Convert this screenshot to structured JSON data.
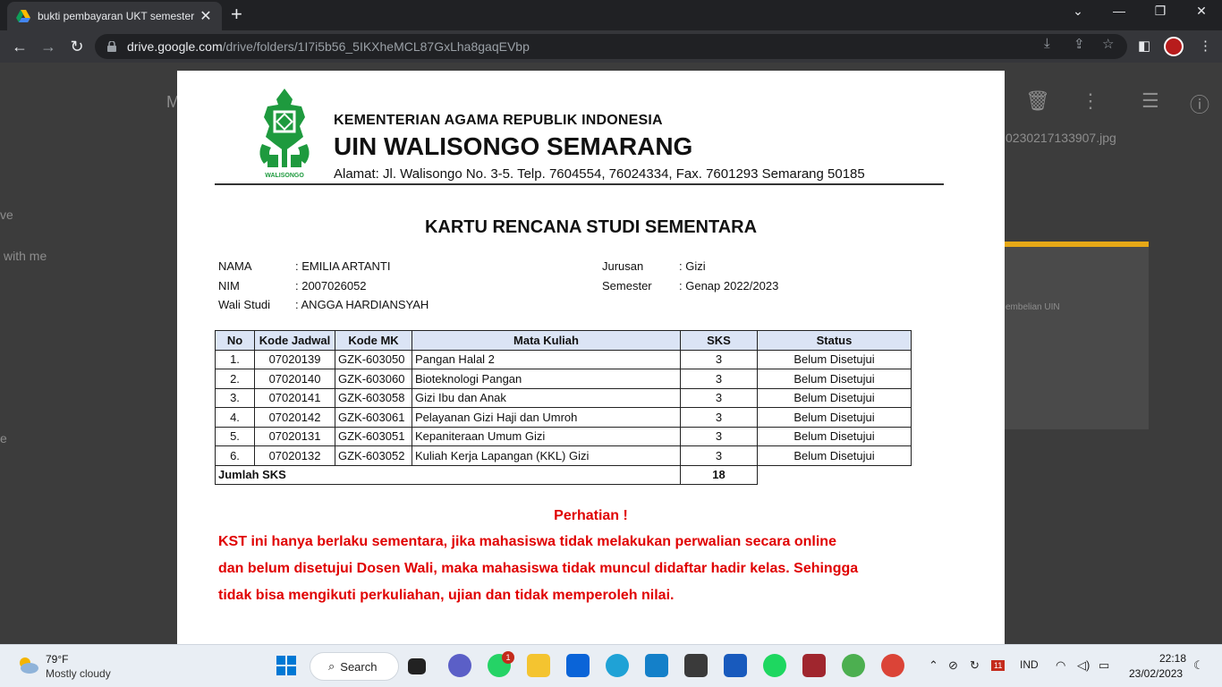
{
  "browser": {
    "tab_title": "bukti pembayaran UKT semester",
    "tab_close": "✕",
    "new_tab": "+",
    "url_host": "drive.google.com",
    "url_path": "/drive/folders/1I7i5b56_5IKXheMCL87GxLha8gaqEVbp",
    "minimize": "⌄",
    "minimize2": "—",
    "restore": "❐",
    "close": "✕"
  },
  "drive_background": {
    "partial_top": "M",
    "partial_left_1": "ve",
    "partial_left_2": "with me",
    "partial_left_3": "e",
    "file_name": "0230217133907.jpg",
    "thumb_text": "embelian UIN"
  },
  "document": {
    "ministry": "KEMENTERIAN AGAMA REPUBLIK INDONESIA",
    "university": "UIN WALISONGO SEMARANG",
    "address": "Alamat: Jl. Walisongo No. 3-5. Telp. 7604554, 76024334, Fax. 7601293 Semarang 50185",
    "logo_text": "WALISONGO",
    "title": "KARTU RENCANA STUDI SEMENTARA",
    "info": {
      "nama_label": "NAMA",
      "nama_value": ": EMILIA ARTANTI",
      "nim_label": "NIM",
      "nim_value": ": 2007026052",
      "wali_label": "Wali Studi",
      "wali_value": ": ANGGA HARDIANSYAH",
      "jurusan_label": "Jurusan",
      "jurusan_value": ": Gizi",
      "semester_label": "Semester",
      "semester_value": ": Genap 2022/2023"
    },
    "table": {
      "headers": [
        "No",
        "Kode Jadwal",
        "Kode MK",
        "Mata Kuliah",
        "SKS",
        "Status"
      ],
      "rows": [
        [
          "1.",
          "07020139",
          "GZK-603050",
          "Pangan Halal 2",
          "3",
          "Belum Disetujui"
        ],
        [
          "2.",
          "07020140",
          "GZK-603060",
          "Bioteknologi Pangan",
          "3",
          "Belum Disetujui"
        ],
        [
          "3.",
          "07020141",
          "GZK-603058",
          "Gizi Ibu dan Anak",
          "3",
          "Belum Disetujui"
        ],
        [
          "4.",
          "07020142",
          "GZK-603061",
          "Pelayanan Gizi Haji dan Umroh",
          "3",
          "Belum Disetujui"
        ],
        [
          "5.",
          "07020131",
          "GZK-603051",
          "Kepaniteraan Umum Gizi",
          "3",
          "Belum Disetujui"
        ],
        [
          "6.",
          "07020132",
          "GZK-603052",
          "Kuliah Kerja Lapangan (KKL) Gizi",
          "3",
          "Belum Disetujui"
        ]
      ],
      "total_label": "Jumlah SKS",
      "total_value": "18"
    },
    "warning": {
      "heading": "Perhatian !",
      "line1": "KST ini hanya berlaku sementara, jika mahasiswa tidak melakukan perwalian secara online",
      "line2": "dan belum disetujui Dosen Wali, maka mahasiswa tidak muncul didaftar hadir kelas. Sehingga",
      "line3": "tidak bisa mengikuti perkuliahan, ujian dan tidak memperoleh nilai."
    }
  },
  "taskbar": {
    "temperature": "79°F",
    "weather": "Mostly cloudy",
    "search_label": "Search",
    "whatsapp_badge": "1",
    "calendar_day": "11",
    "language": "IND",
    "time": "22:18",
    "date": "23/02/2023"
  },
  "colors": {
    "warning_red": "#e00000",
    "table_header": "#dbe4f5",
    "logo_green": "#1e9a3e"
  }
}
